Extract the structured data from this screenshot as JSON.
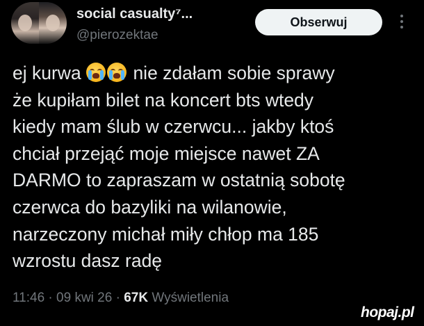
{
  "author": {
    "display_name": "social casualty⁷...",
    "handle": "@pierozektae"
  },
  "actions": {
    "follow_label": "Obserwuj",
    "more_icon": "more-vertical-icon"
  },
  "tweet": {
    "lines": [
      "nie zdałam sobie sprawy",
      "że kupiłam bilet na koncert bts wtedy",
      "kiedy mam ślub w czerwcu... jakby ktoś",
      "chciał przejąć moje miejsce nawet ZA",
      "DARMO to zapraszam w ostatnią sobotę",
      "czerwca do bazyliki na wilanowie,",
      "narzeczony michał miły chłop ma 185",
      "wzrostu dasz radę"
    ],
    "first_line_prefix": "ej kurwa",
    "emojis": [
      "loudly-crying-face-emoji",
      "loudly-crying-face-emoji"
    ]
  },
  "meta": {
    "time": "11:46",
    "sep1": " · ",
    "date": "09 kwi 26",
    "sep2": " · ",
    "views_count": "67K",
    "views_label": " Wyświetlenia"
  },
  "watermark": "hopaj.pl",
  "colors": {
    "background": "#000000",
    "primary_text": "#e7e9ea",
    "secondary_text": "#71767b",
    "button_bg": "#eff3f4"
  }
}
